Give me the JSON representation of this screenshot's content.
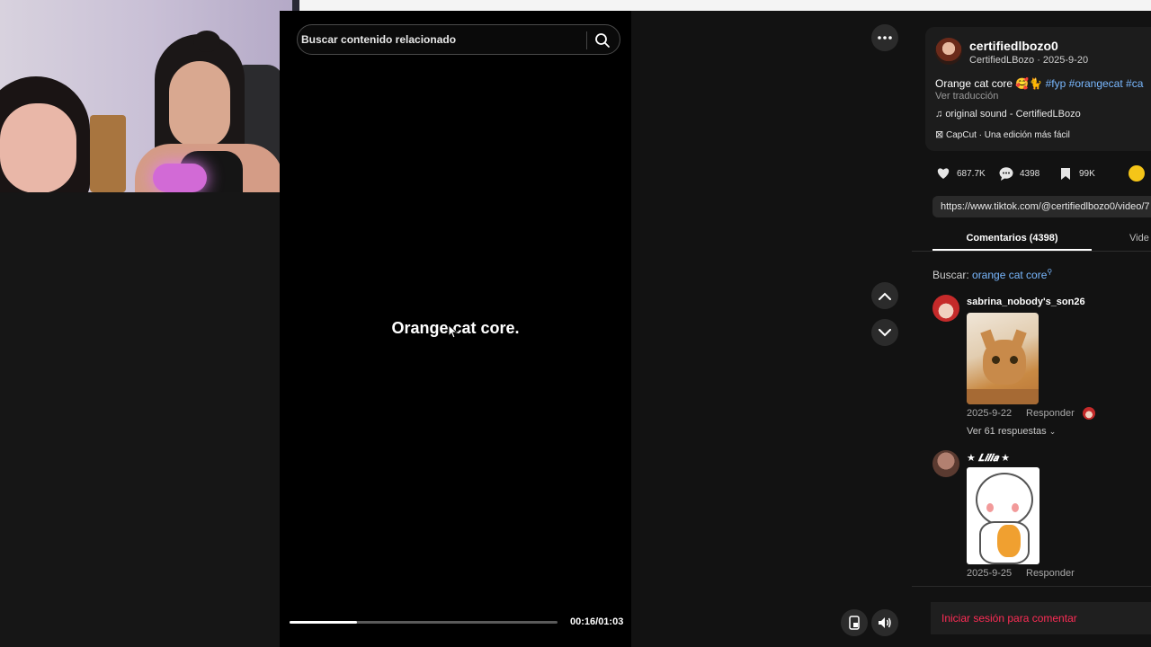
{
  "search": {
    "placeholder": "Buscar contenido relacionado"
  },
  "video": {
    "caption": "Orange cat core.",
    "progress": 0.25,
    "time": "00:16/01:03"
  },
  "post": {
    "username": "certifiedlbozo0",
    "display_and_date": "CertifiedLBozo · 2025-9-20",
    "description_text": "Orange cat core ",
    "emoji": "🥰🐈",
    "hashtags": "#fyp #orangecat #ca",
    "translate": "Ver traducción",
    "sound": "original sound - CertifiedLBozo",
    "capcut": "CapCut · Una edición más fácil",
    "likes": "687.7K",
    "comments": "4398",
    "saves": "99K",
    "url": "https://www.tiktok.com/@certifiedlbozo0/video/7"
  },
  "tabs": {
    "comments": "Comentarios (4398)",
    "videos": "Vide"
  },
  "comment_search": {
    "label": "Buscar: ",
    "query": "orange cat core"
  },
  "comments": [
    {
      "user": "sabrina_nobody's_son26",
      "date": "2025-9-22",
      "reply": "Responder",
      "replies": "Ver 61 respuestas"
    },
    {
      "user": "★ 𝑳𝒊𝒍𝒊𝒂 ★",
      "date": "2025-9-25",
      "reply": "Responder"
    }
  ],
  "login": {
    "label": "Iniciar sesión para comentar"
  },
  "colors": {
    "accent": "#fe2c55",
    "hashtag": "#79b8ff",
    "panel": "#121212"
  }
}
